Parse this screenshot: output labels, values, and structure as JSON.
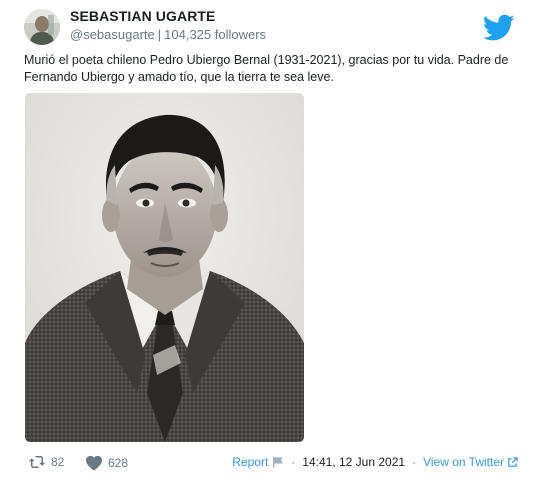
{
  "header": {
    "display_name": "SEBASTIAN UGARTE",
    "handle": "@sebasugarte",
    "separator": "|",
    "followers": "104,325 followers"
  },
  "tweet": {
    "text": "Murió el poeta chileno Pedro Ubiergo Bernal (1931-2021), gracias por tu vida. Padre de Fernando Ubiergo y amado tío, que la tierra te sea leve."
  },
  "footer": {
    "retweets": "82",
    "likes": "628",
    "report_label": "Report",
    "timestamp": "14:41, 12 Jun 2021",
    "dot": "·",
    "view_on_label": "View on Twitter"
  },
  "icons": {
    "brand": "twitter-bird-icon",
    "retweet": "retweet-icon",
    "like": "heart-icon",
    "report": "flag-icon",
    "external": "external-link-icon"
  },
  "colors": {
    "twitter_blue": "#1da1f2",
    "link_blue": "#3b94d9",
    "muted": "#697882",
    "text": "#1c2022"
  }
}
